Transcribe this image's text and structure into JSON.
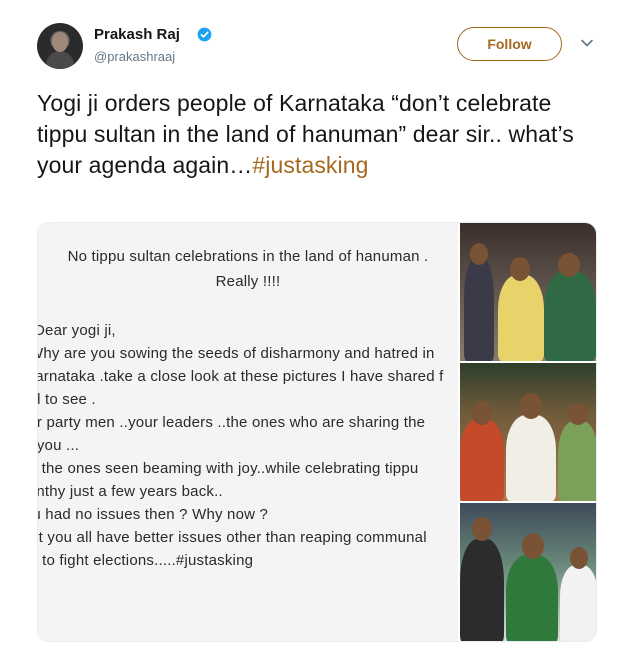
{
  "user": {
    "name": "Prakash Raj",
    "handle": "@prakashraaj",
    "verified": true,
    "avatar_icon": "profile-photo"
  },
  "actions": {
    "follow_label": "Follow",
    "more_icon": "chevron-down-icon"
  },
  "tweet": {
    "text": "Yogi ji orders people of Karnataka “don’t celebrate tippu sultan in the land of hanuman” dear sir.. what’s your agenda again…",
    "hashtag": "#justasking"
  },
  "media": {
    "note_title_1": "No tippu sultan celebrations in the land of hanuman .",
    "note_title_2": "Really !!!!",
    "note_lines": [
      "Dear yogi ji,",
      "Why are you sowing the seeds of disharmony and hatred in",
      "Karnataka .take a close look at these pictures I have shared f",
      "all to see .",
      "Your party men ..your leaders ..the ones who are sharing the",
      "with you ...",
      "are the ones seen beaming with joy..while celebrating tippu",
      "jayanthy just a few years back..",
      "You had no issues then ? Why now ?",
      "Don’t you all have better issues other than reaping communal",
      "hatred  to fight elections.....#justasking"
    ],
    "photo_icons": [
      "photo-leaders-felicitation",
      "photo-leaders-garlanded",
      "photo-leader-honoured"
    ]
  },
  "colors": {
    "accent": "#a5681f",
    "verified": "#1da1f2",
    "secondary_text": "#657786"
  }
}
